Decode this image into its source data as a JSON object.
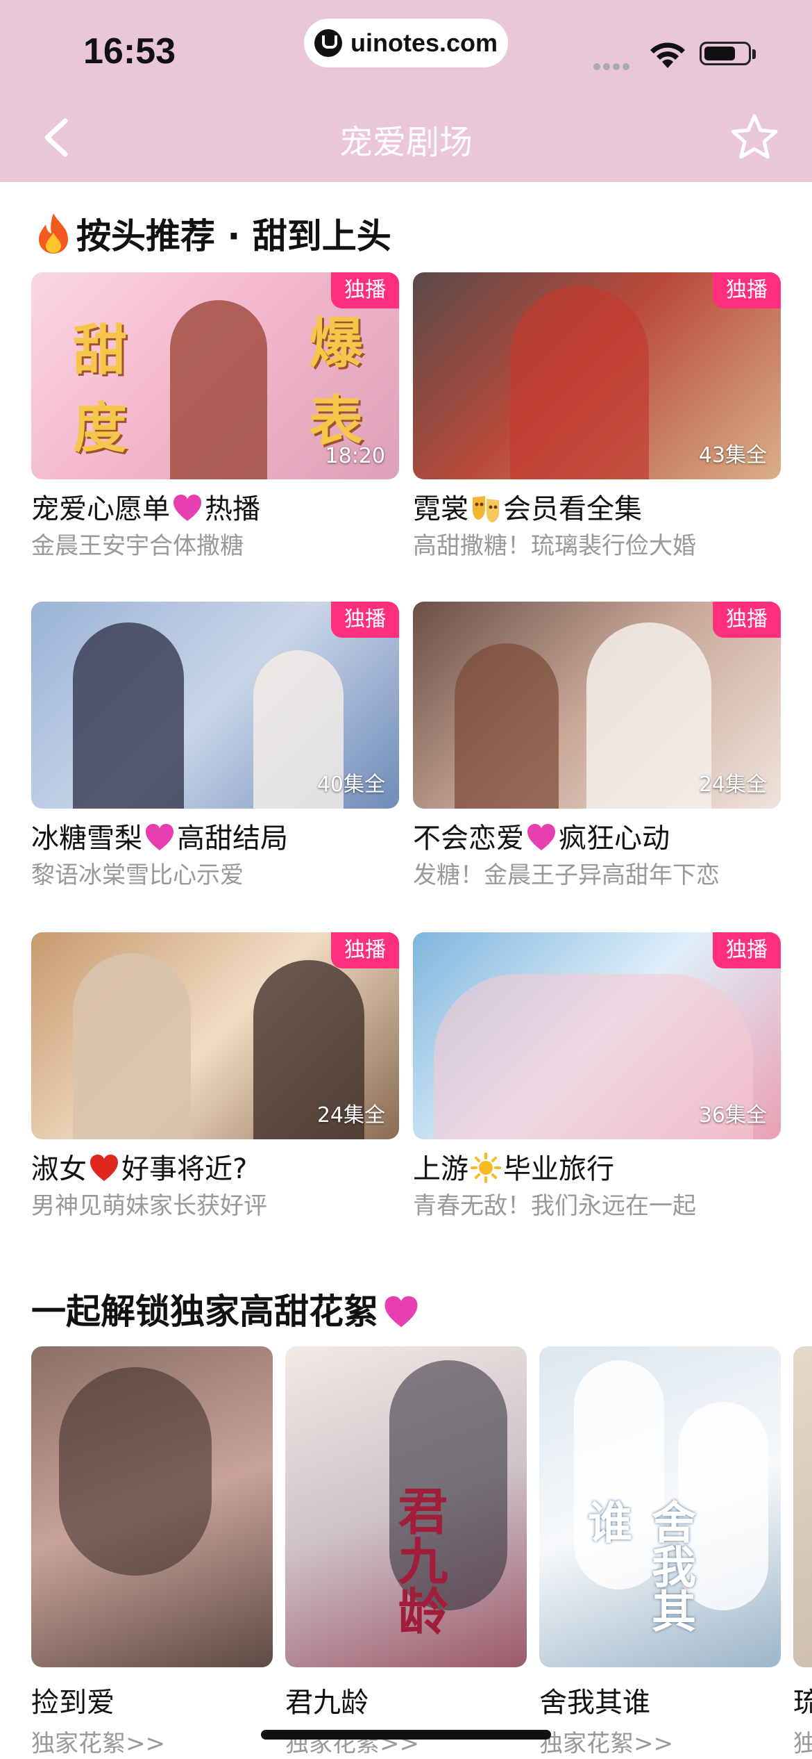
{
  "status_bar": {
    "time": "16:53",
    "url": "uinotes.com"
  },
  "nav": {
    "title": "宠爱剧场"
  },
  "section1": {
    "title": "按头推荐 · 甜到上头",
    "cards": [
      {
        "title_a": "宠爱心愿单",
        "title_b": "热播",
        "emoji": "heart-icon",
        "subtitle": "金晨王安宇合体撒糖",
        "badge": "独播",
        "duration": "18:20",
        "deco_left": "甜度",
        "deco_right": "爆表"
      },
      {
        "title_a": "霓裳",
        "title_b": "会员看全集",
        "emoji": "mask-icon",
        "subtitle": "高甜撒糖！琉璃裴行俭大婚",
        "badge": "独播",
        "duration": "43集全"
      },
      {
        "title_a": "冰糖雪梨",
        "title_b": "高甜结局",
        "emoji": "heart-icon",
        "subtitle": "黎语冰棠雪比心示爱",
        "badge": "独播",
        "duration": "40集全"
      },
      {
        "title_a": "不会恋爱",
        "title_b": "疯狂心动",
        "emoji": "heart-icon",
        "subtitle": "发糖！金晨王子异高甜年下恋",
        "badge": "独播",
        "duration": "24集全"
      },
      {
        "title_a": "淑女",
        "title_b": "好事将近?",
        "emoji": "red-heart-icon",
        "subtitle": "男神见萌妹家长获好评",
        "badge": "独播",
        "duration": "24集全"
      },
      {
        "title_a": "上游",
        "title_b": "毕业旅行",
        "emoji": "sun-icon",
        "subtitle": "青春无敌！我们永远在一起",
        "badge": "独播",
        "duration": "36集全"
      }
    ]
  },
  "section2": {
    "title": "一起解锁独家高甜花絮",
    "posters": [
      {
        "title": "捡到爱",
        "subtitle": "独家花絮>>"
      },
      {
        "title": "君九龄",
        "subtitle": "独家花絮>>",
        "calligraphy": "君九龄"
      },
      {
        "title": "舍我其谁",
        "subtitle": "独家花絮>>",
        "calligraphy": "舍我其谁"
      },
      {
        "title": "琉",
        "subtitle": "独"
      }
    ]
  }
}
